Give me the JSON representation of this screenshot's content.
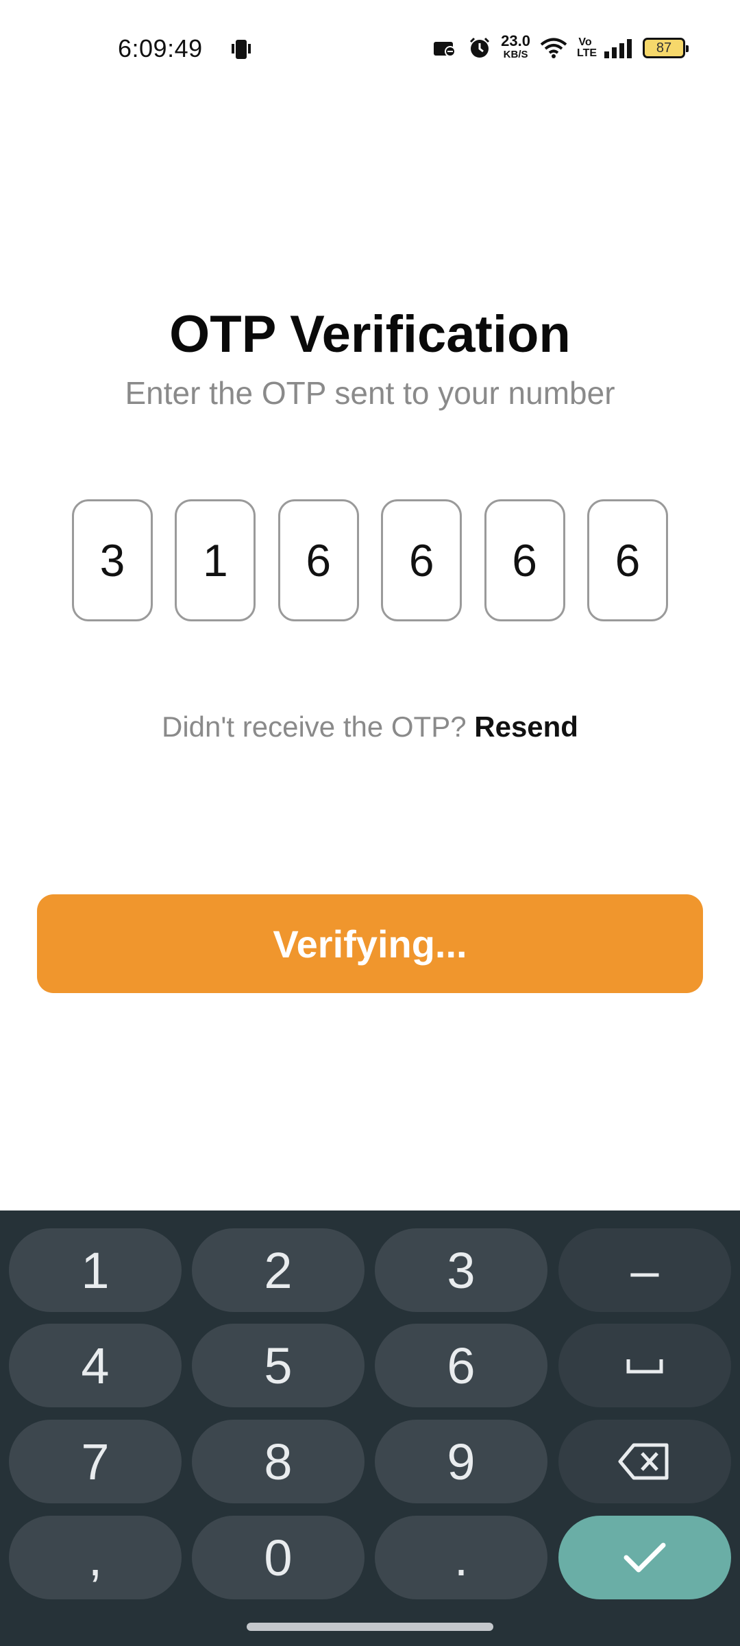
{
  "status_bar": {
    "time": "6:09:49",
    "net_speed": "23.0",
    "net_unit": "KB/S",
    "volte": "Vo LTE",
    "battery": "87"
  },
  "screen": {
    "title": "OTP Verification",
    "subtitle": "Enter the OTP sent to your number",
    "otp_digits": [
      "3",
      "1",
      "6",
      "6",
      "6",
      "6"
    ],
    "resend_prompt": "Didn't receive the OTP?",
    "resend_link": "Resend",
    "verify_button": "Verifying...",
    "accent_color": "#f0962d"
  },
  "keyboard": {
    "keys": {
      "k1": "1",
      "k2": "2",
      "k3": "3",
      "dash": "–",
      "k4": "4",
      "k5": "5",
      "k6": "6",
      "k7": "7",
      "k8": "8",
      "k9": "9",
      "comma": ",",
      "k0": "0",
      "dot": "."
    },
    "icons": {
      "space": "space-bar-icon",
      "backspace": "backspace-icon",
      "enter": "checkmark-icon"
    },
    "enter_color": "#6aaea6",
    "background": "#263238"
  }
}
